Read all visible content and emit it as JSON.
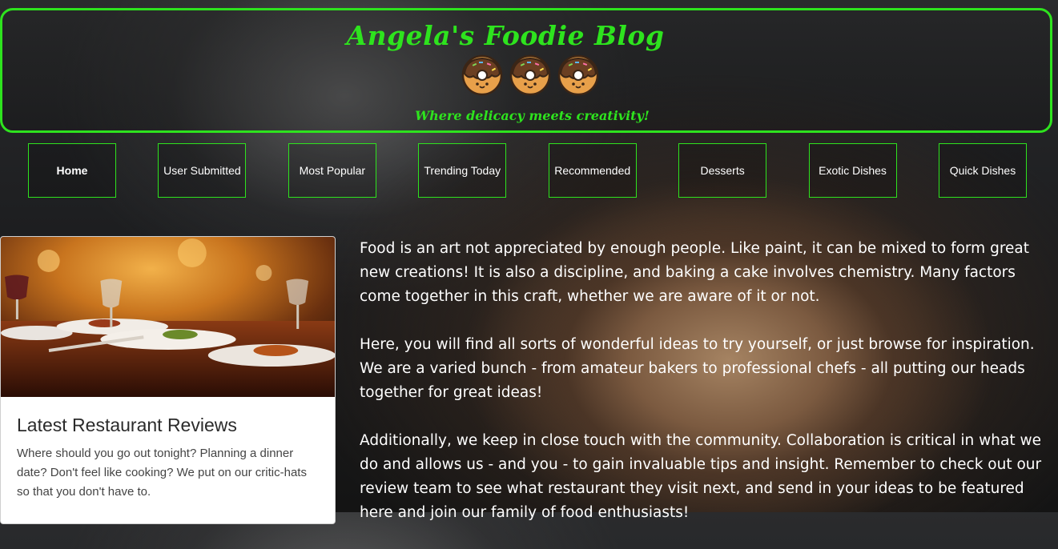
{
  "header": {
    "title": "Angela's Foodie Blog",
    "tagline": "Where delicacy meets creativity!",
    "accent_color": "#2ee31e",
    "donut_icons": [
      "donut-icon",
      "donut-icon",
      "donut-icon"
    ]
  },
  "nav": {
    "items": [
      {
        "label": "Home",
        "active": true
      },
      {
        "label": "User Submitted",
        "active": false
      },
      {
        "label": "Most Popular",
        "active": false
      },
      {
        "label": "Trending Today",
        "active": false
      },
      {
        "label": "Recommended",
        "active": false
      },
      {
        "label": "Desserts",
        "active": false
      },
      {
        "label": "Exotic Dishes",
        "active": false
      },
      {
        "label": "Quick Dishes",
        "active": false
      }
    ]
  },
  "card": {
    "image_subject": "restaurant-table-photo",
    "title": "Latest Restaurant Reviews",
    "text": "Where should you go out tonight? Planning a dinner date? Don't feel like cooking? We put on our critic-hats so that you don't have to."
  },
  "main": {
    "paragraphs": [
      "Food is an art not appreciated by enough people. Like paint, it can be mixed to form great new creations! It is also a discipline, and baking a cake involves chemistry. Many factors come together in this craft, whether we are aware of it or not.",
      "Here, you will find all sorts of wonderful ideas to try yourself, or just browse for inspiration. We are a varied bunch - from amateur bakers to professional chefs - all putting our heads together for great ideas!",
      "Additionally, we keep in close touch with the community. Collaboration is critical in what we do and allows us - and you - to gain invaluable tips and insight. Remember to check out our review team to see what restaurant they visit next, and send in your ideas to be featured here and join our family of food enthusiasts!"
    ]
  }
}
